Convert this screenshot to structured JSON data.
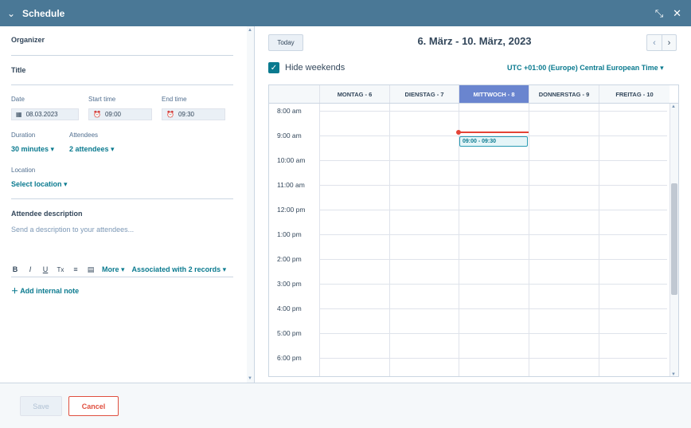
{
  "header": {
    "title": "Schedule",
    "collapse_icon": "chevron-down-icon",
    "minimize_icon": "shrink-icon",
    "close_icon": "close-icon"
  },
  "form": {
    "organizer_label": "Organizer",
    "title_label": "Title",
    "date_label": "Date",
    "date_value": "08.03.2023",
    "start_label": "Start time",
    "start_value": "09:00",
    "end_label": "End time",
    "end_value": "09:30",
    "duration_label": "Duration",
    "duration_value": "30 minutes",
    "attendees_label": "Attendees",
    "attendees_value": "2 attendees",
    "location_label": "Location",
    "location_value": "Select location",
    "desc_label": "Attendee description",
    "desc_placeholder": "Send a description to your attendees...",
    "toolbar": {
      "bold": "B",
      "italic": "I",
      "underline": "U",
      "clear": "Tx",
      "strike": "≡",
      "doc": "▤",
      "more": "More",
      "associated": "Associated with 2 records"
    },
    "add_note": "Add internal note"
  },
  "calendar": {
    "today_label": "Today",
    "range_title": "6. März - 10. März, 2023",
    "hide_weekends_label": "Hide weekends",
    "hide_weekends_checked": true,
    "timezone": "UTC +01:00 (Europe) Central European Time",
    "days": [
      {
        "label": "MONTAG - 6",
        "active": false
      },
      {
        "label": "DIENSTAG - 7",
        "active": false
      },
      {
        "label": "MITTWOCH - 8",
        "active": true
      },
      {
        "label": "DONNERSTAG - 9",
        "active": false
      },
      {
        "label": "FREITAG - 10",
        "active": false
      }
    ],
    "times": [
      "8:00 am",
      "9:00 am",
      "10:00 am",
      "11:00 am",
      "12:00 pm",
      "1:00 pm",
      "2:00 pm",
      "3:00 pm",
      "4:00 pm",
      "5:00 pm",
      "6:00 pm"
    ],
    "event": {
      "label": "09:00 - 09:30",
      "day_index": 2,
      "start": "09:00",
      "end": "09:30"
    },
    "now_time": "09:00",
    "colors": {
      "accent": "#0a7a8f",
      "active_day": "#6a85cf",
      "now_line": "#e44336",
      "header": "#4a7896"
    }
  },
  "footer": {
    "save_label": "Save",
    "cancel_label": "Cancel"
  }
}
